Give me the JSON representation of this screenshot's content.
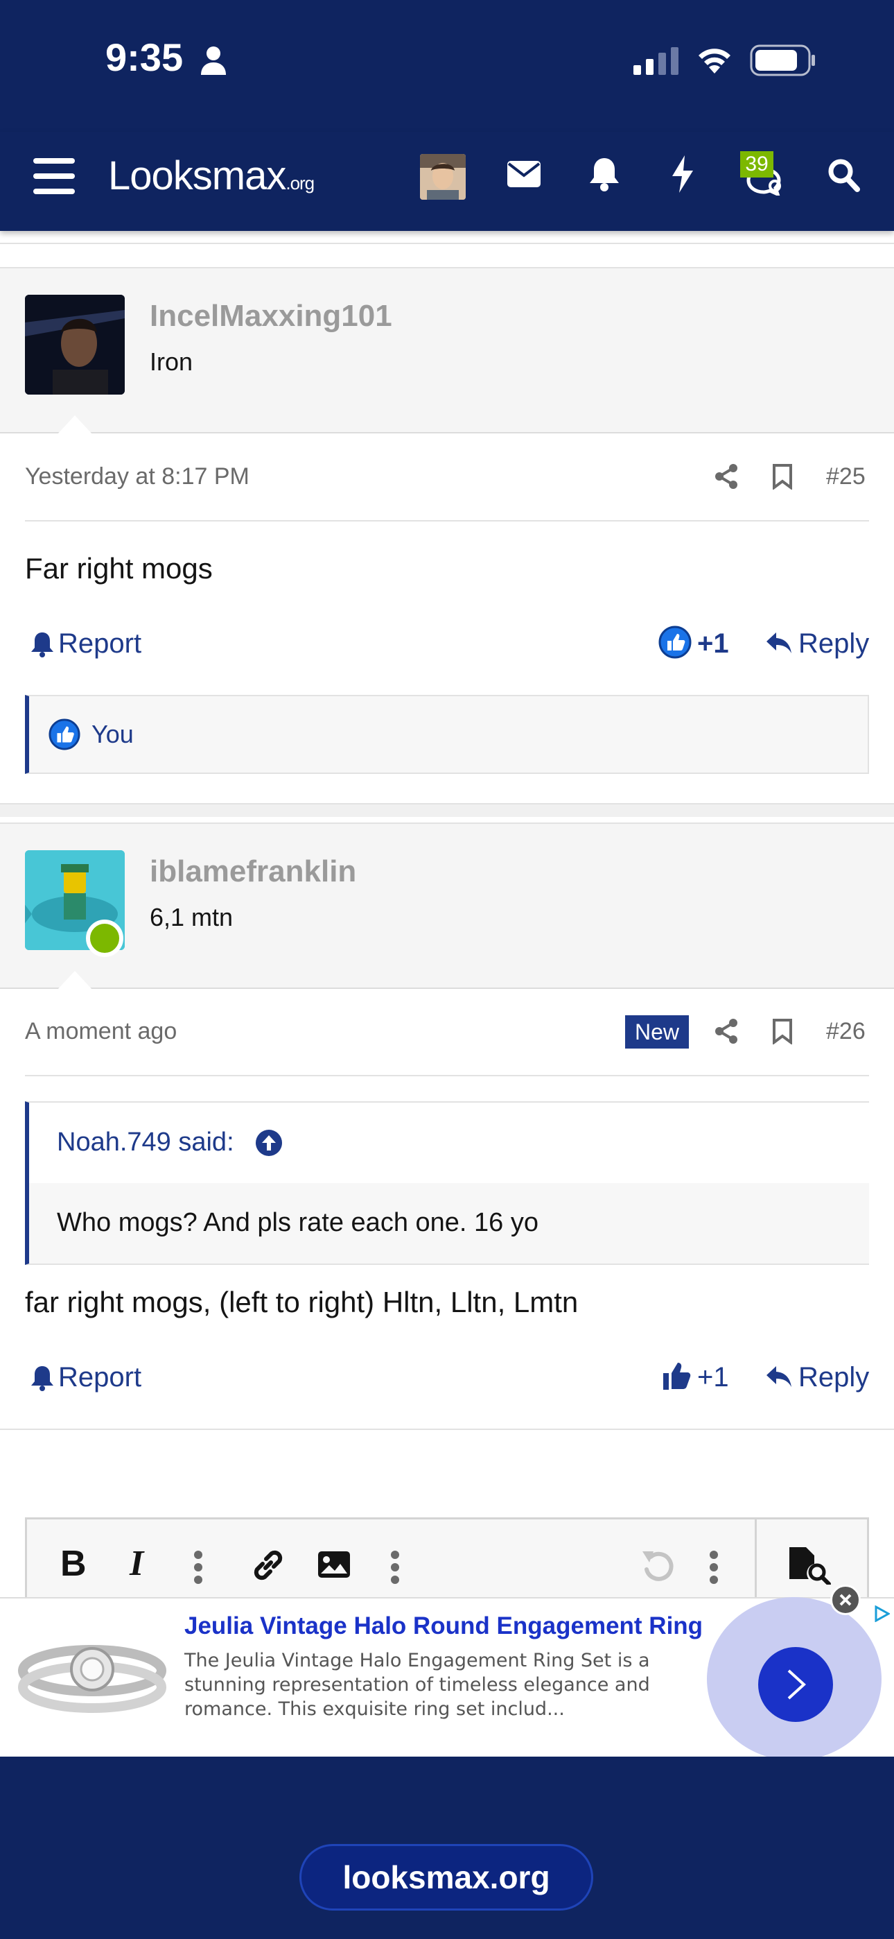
{
  "status": {
    "time": "9:35"
  },
  "header": {
    "logo": "Looksmax",
    "logo_suffix": ".org",
    "badge_count": "39"
  },
  "posts": [
    {
      "username": "IncelMaxxing101",
      "user_title": "Iron",
      "timestamp": "Yesterday at 8:17 PM",
      "post_number": "#25",
      "body": "Far right mogs",
      "report_label": "Report",
      "reaction_count": "+1",
      "reply_label": "Reply",
      "reactions_by": "You"
    },
    {
      "username": "iblamefranklin",
      "user_title": "6,1 mtn",
      "timestamp": "A moment ago",
      "new_badge": "New",
      "post_number": "#26",
      "quote_author": "Noah.749 said:",
      "quote_text": "Who mogs? And pls rate each one. 16 yo",
      "body": "far right mogs, (left to right) Hltn, Lltn, Lmtn",
      "report_label": "Report",
      "reaction_count": "+1",
      "reply_label": "Reply"
    }
  ],
  "editor": {
    "toolbar": [
      "bold",
      "italic",
      "more",
      "link",
      "image",
      "more",
      "undo",
      "more",
      "preview"
    ]
  },
  "ad": {
    "title": "Jeulia Vintage Halo Round Engagement Ring",
    "description": "The Jeulia Vintage Halo Engagement Ring Set is a stunning representation of timeless elegance and romance. This exquisite ring set includ..."
  },
  "footer": {
    "url": "looksmax.org"
  },
  "colors": {
    "navy": "#0f2460",
    "link": "#1e3a8a",
    "like_blue": "#1a73e8",
    "online": "#7cb800"
  }
}
